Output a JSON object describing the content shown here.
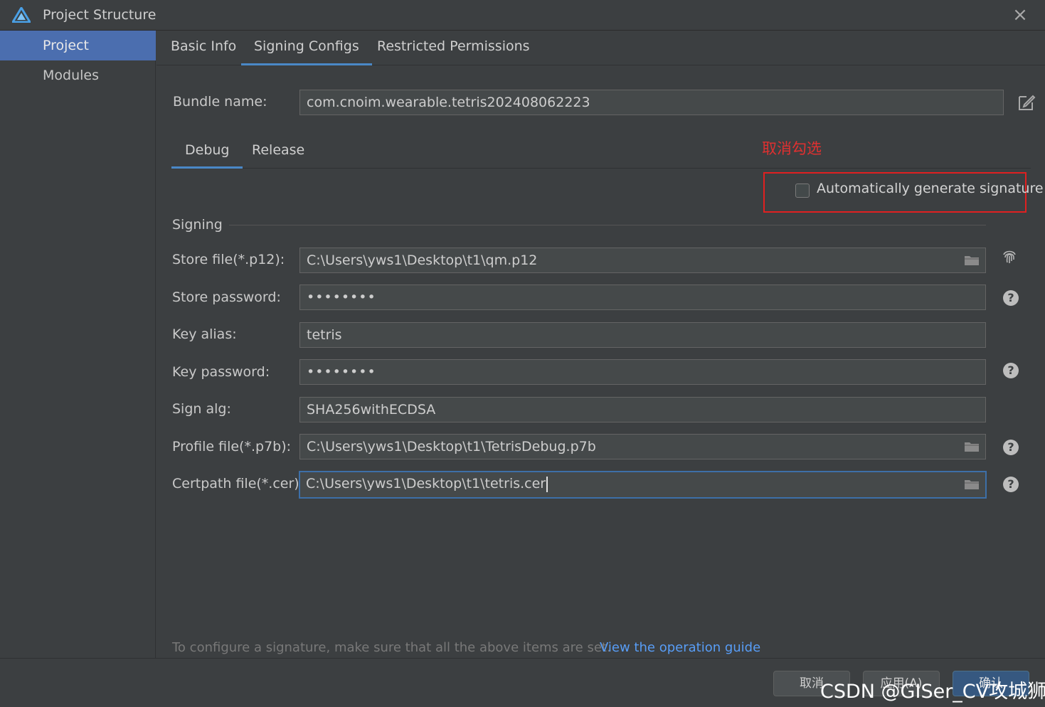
{
  "window": {
    "title": "Project Structure"
  },
  "sidebar": {
    "items": [
      {
        "label": "Project",
        "selected": true
      },
      {
        "label": "Modules",
        "selected": false
      }
    ]
  },
  "tabs": [
    {
      "label": "Basic Info"
    },
    {
      "label": "Signing Configs",
      "active": true
    },
    {
      "label": "Restricted Permissions"
    }
  ],
  "bundle": {
    "label": "Bundle name:",
    "value": "com.cnoim.wearable.tetris202408062223"
  },
  "sub_tabs": [
    {
      "label": "Debug",
      "active": true
    },
    {
      "label": "Release"
    }
  ],
  "annotation": "取消勾选",
  "auto_sign": {
    "label": "Automatically generate signature",
    "checked": false
  },
  "signing": {
    "section_title": "Signing",
    "store_file": {
      "label": "Store file(*.p12):",
      "value": "C:\\Users\\yws1\\Desktop\\t1\\qm.p12"
    },
    "store_password": {
      "label": "Store password:",
      "value": "••••••••"
    },
    "key_alias": {
      "label": "Key alias:",
      "value": "tetris"
    },
    "key_password": {
      "label": "Key password:",
      "value": "••••••••"
    },
    "sign_alg": {
      "label": "Sign alg:",
      "value": "SHA256withECDSA"
    },
    "profile_file": {
      "label": "Profile file(*.p7b):",
      "value": "C:\\Users\\yws1\\Desktop\\t1\\TetrisDebug.p7b"
    },
    "certpath_file": {
      "label": "Certpath file(*.cer):",
      "value": "C:\\Users\\yws1\\Desktop\\t1\\tetris.cer"
    }
  },
  "hint": "To configure a signature, make sure that all the above items are set.",
  "guide_link": "View the operation guide",
  "buttons": {
    "cancel": "取消",
    "apply": "应用(A)",
    "ok": "确认"
  },
  "watermark": "CSDN @GISer_CV攻城狮",
  "help_glyph": "?",
  "colors": {
    "accent": "#4b6eaf",
    "tab_underline": "#4a88c7",
    "link": "#589df6",
    "annotation": "#e03030",
    "background": "#3c3f41"
  },
  "icons": [
    "app-logo-icon",
    "close-icon",
    "edit-icon",
    "folder-icon",
    "fingerprint-icon",
    "help-icon"
  ]
}
